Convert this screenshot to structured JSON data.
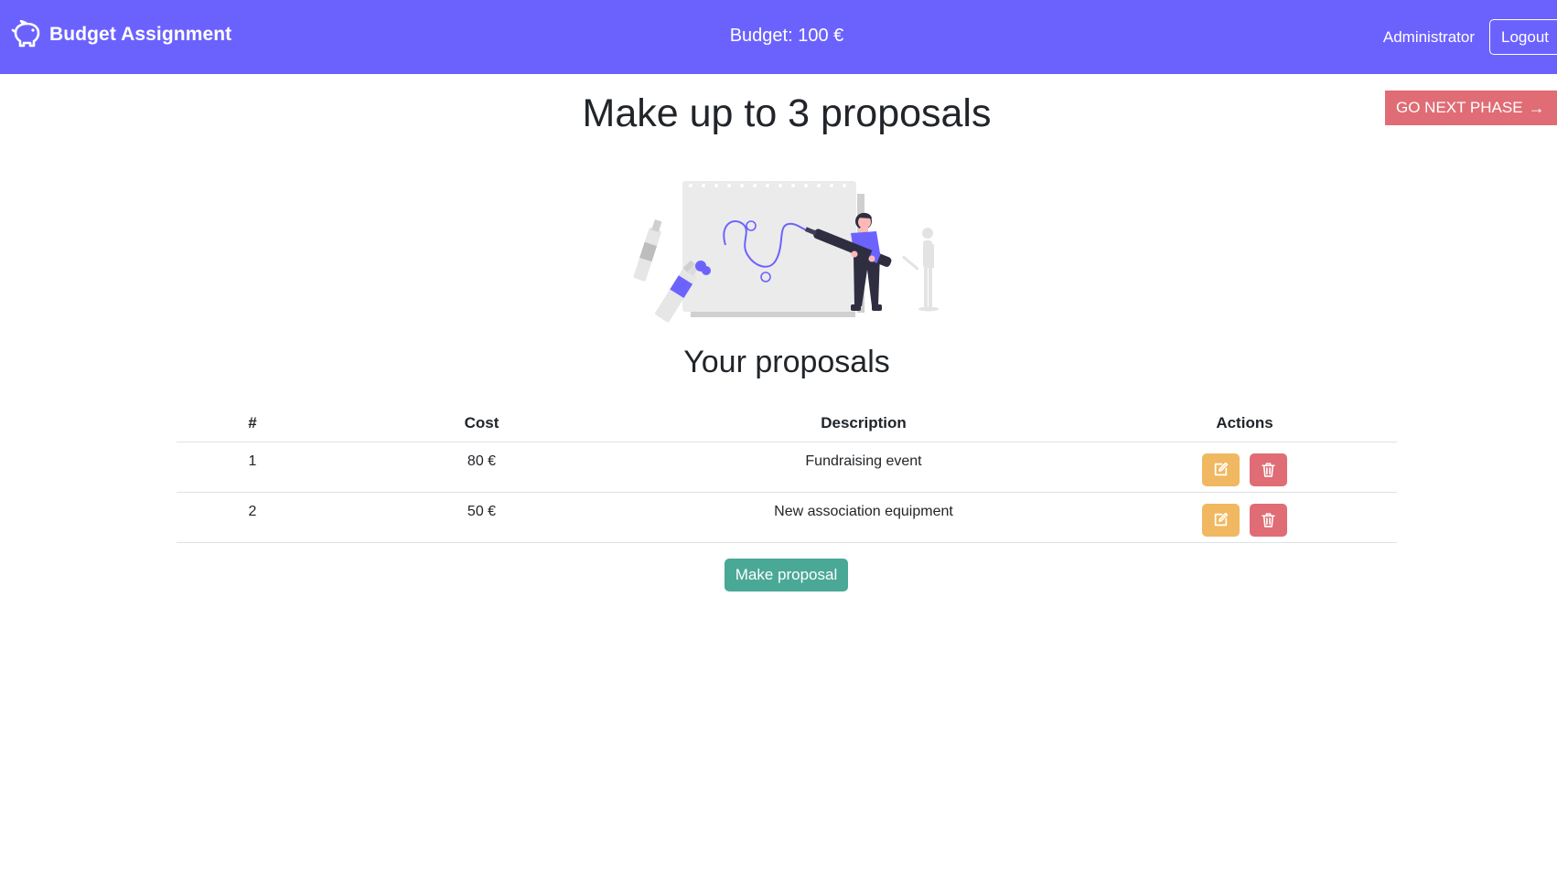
{
  "navbar": {
    "brand_icon": "piggy-bank-icon",
    "brand_text": "Budget Assignment",
    "budget_text": "Budget: 100 €",
    "user_name": "Administrator",
    "logout_label": "Logout",
    "background_color": "#6b62fe"
  },
  "phase_button": {
    "label": "GO NEXT PHASE",
    "arrow": "→",
    "color": "#e06c75"
  },
  "page": {
    "title": "Make up to 3 proposals",
    "illustration": "drawing-woman-illustration"
  },
  "proposals": {
    "section_title": "Your proposals",
    "columns": [
      "#",
      "Cost",
      "Description",
      "Actions"
    ],
    "rows": [
      {
        "num": "1",
        "cost": "80 €",
        "description": "Fundraising event"
      },
      {
        "num": "2",
        "cost": "50 €",
        "description": "New association equipment"
      }
    ],
    "edit_icon": "edit-icon",
    "delete_icon": "trash-icon",
    "edit_color": "#f0b860",
    "delete_color": "#e06c75"
  },
  "make_proposal": {
    "label": "Make proposal",
    "color": "#4aa896"
  }
}
